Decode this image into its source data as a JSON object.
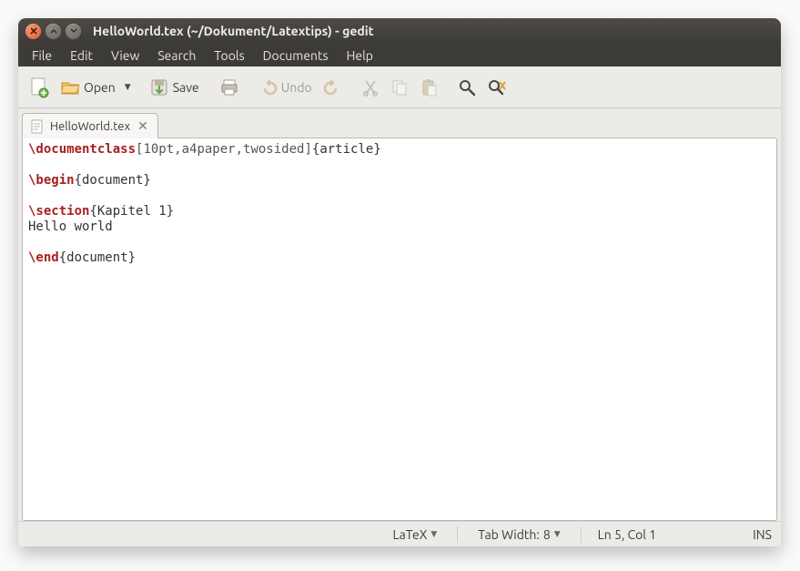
{
  "window": {
    "title": "HelloWorld.tex (~/Dokument/Latextips) - gedit"
  },
  "menu": {
    "file": "File",
    "edit": "Edit",
    "view": "View",
    "search": "Search",
    "tools": "Tools",
    "documents": "Documents",
    "help": "Help"
  },
  "toolbar": {
    "open": "Open",
    "save": "Save",
    "undo": "Undo"
  },
  "tab": {
    "filename": "HelloWorld.tex"
  },
  "editor": {
    "l1_cmd": "\\documentclass",
    "l1_opt": "[10pt,a4paper,twosided]",
    "l1_arg": "{article}",
    "l3_cmd": "\\begin",
    "l3_arg": "{document}",
    "l5_cmd": "\\section",
    "l5_arg": "{Kapitel 1}",
    "l6": "Hello world",
    "l8_cmd": "\\end",
    "l8_arg": "{document}"
  },
  "status": {
    "syntax": "LaTeX",
    "tabwidth_label": "Tab Width:",
    "tabwidth_value": "8",
    "cursor": "Ln 5, Col 1",
    "ins": "INS"
  }
}
